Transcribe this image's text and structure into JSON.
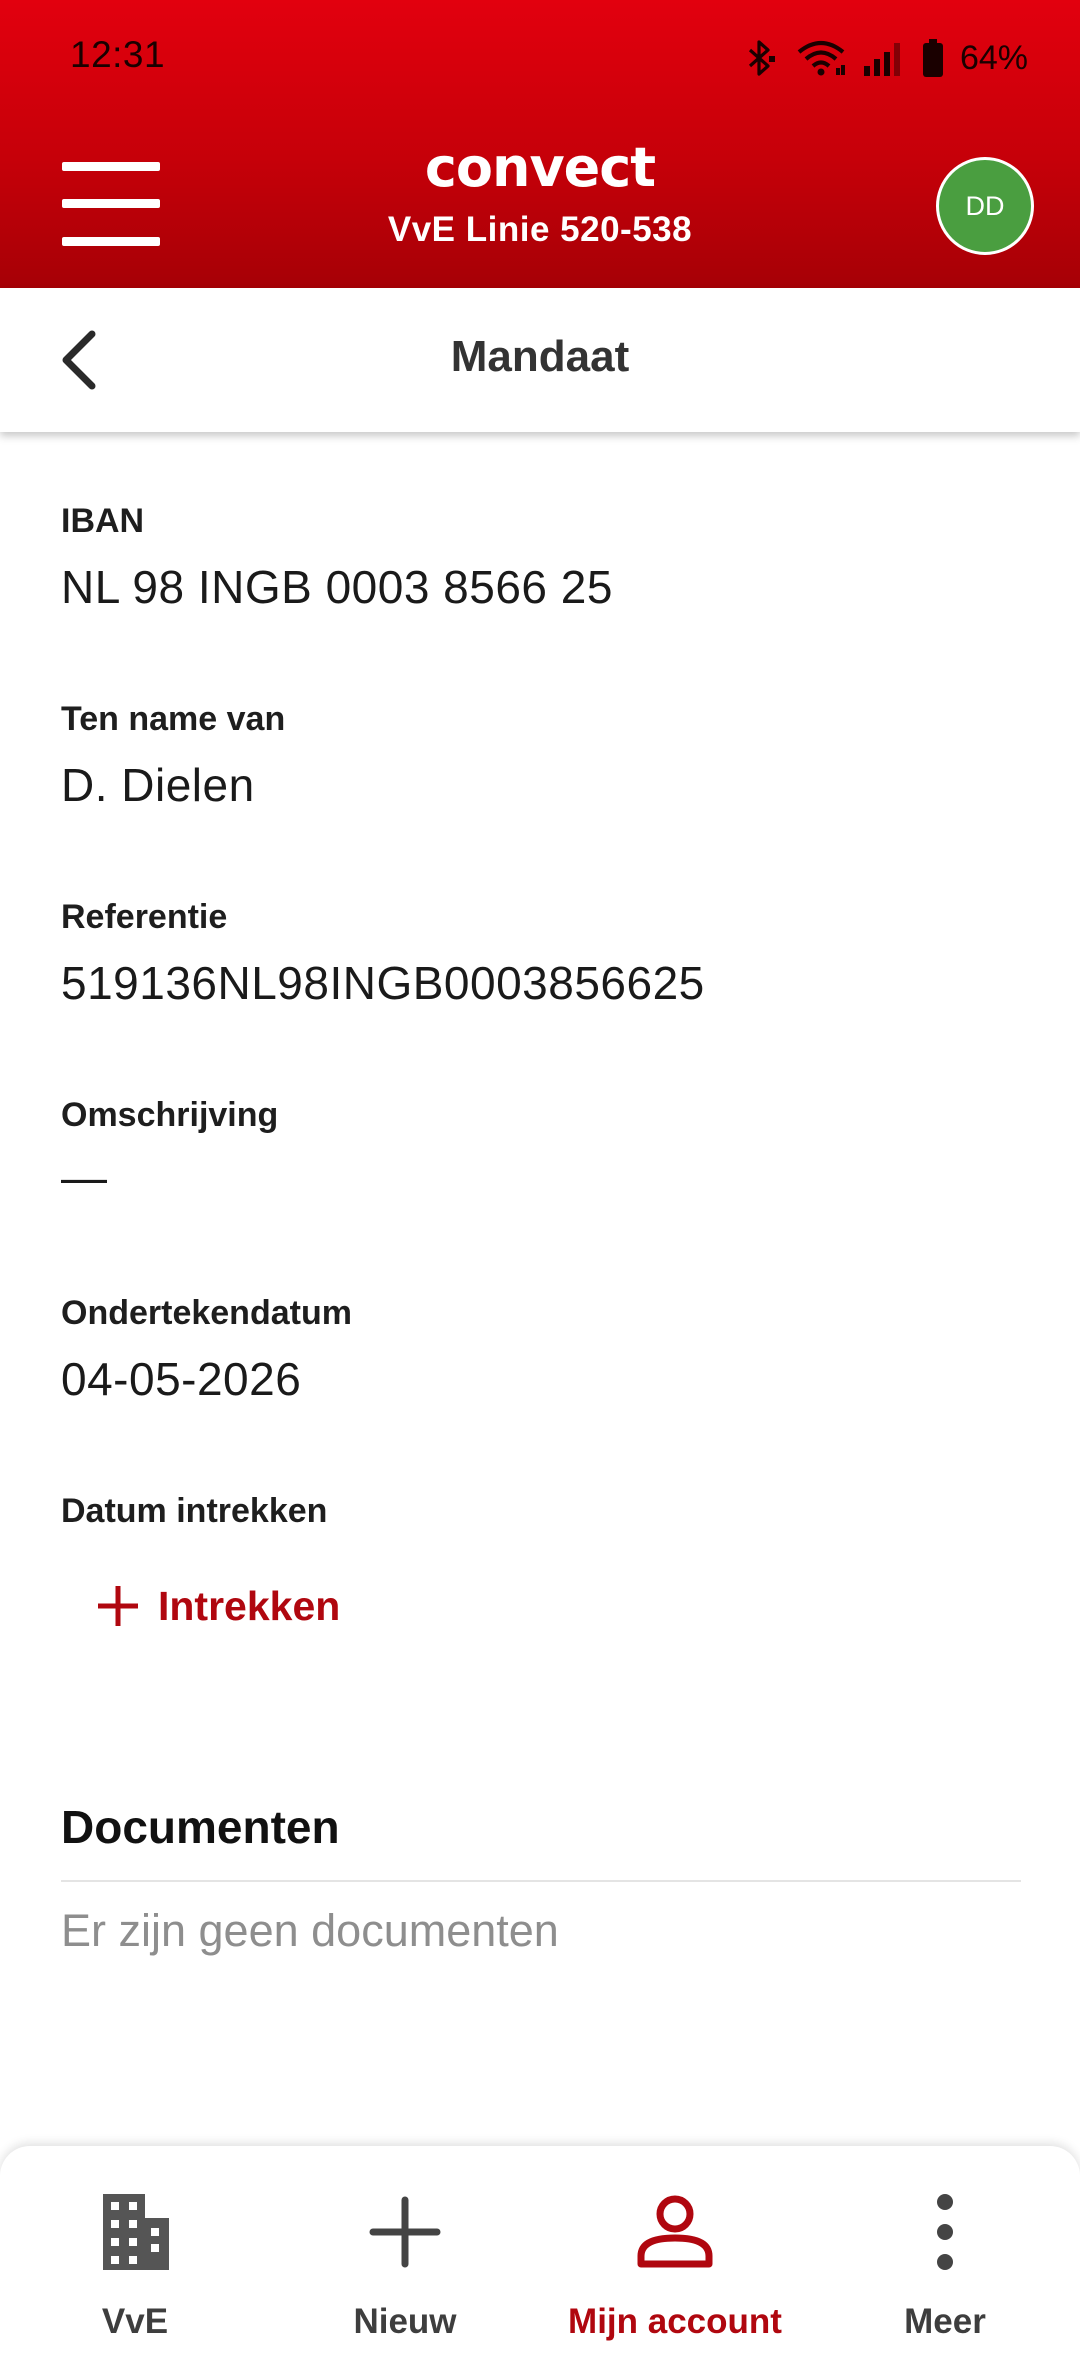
{
  "status_bar": {
    "time": "12:31",
    "battery": "64%",
    "icons": [
      "bluetooth-icon",
      "wifi-icon",
      "signal-icon",
      "battery-icon"
    ]
  },
  "header": {
    "brand": "convect",
    "vve_name": "VvE Linie 520-538",
    "avatar_initials": "DD",
    "accent_color": "#c60009",
    "avatar_color": "#4a9e40"
  },
  "subheader": {
    "title": "Mandaat"
  },
  "fields": {
    "iban": {
      "label": "IBAN",
      "value": "NL 98 INGB 0003 8566 25"
    },
    "ten_name_van": {
      "label": "Ten name van",
      "value": "D. Dielen"
    },
    "referentie": {
      "label": "Referentie",
      "value": "519136NL98INGB0003856625"
    },
    "omschrijving": {
      "label": "Omschrijving",
      "value": "—"
    },
    "ondertekendatum": {
      "label": "Ondertekendatum",
      "value": "04-05-2026"
    },
    "datum_intrekken": {
      "label": "Datum intrekken"
    }
  },
  "revoke": {
    "label": "Intrekken"
  },
  "documents": {
    "title": "Documenten",
    "empty_text": "Er zijn geen documenten"
  },
  "bottom_nav": {
    "items": [
      {
        "label": "VvE",
        "icon": "building-icon",
        "active": false
      },
      {
        "label": "Nieuw",
        "icon": "plus-icon",
        "active": false
      },
      {
        "label": "Mijn account",
        "icon": "person-icon",
        "active": true
      },
      {
        "label": "Meer",
        "icon": "more-vertical-icon",
        "active": false
      }
    ]
  }
}
